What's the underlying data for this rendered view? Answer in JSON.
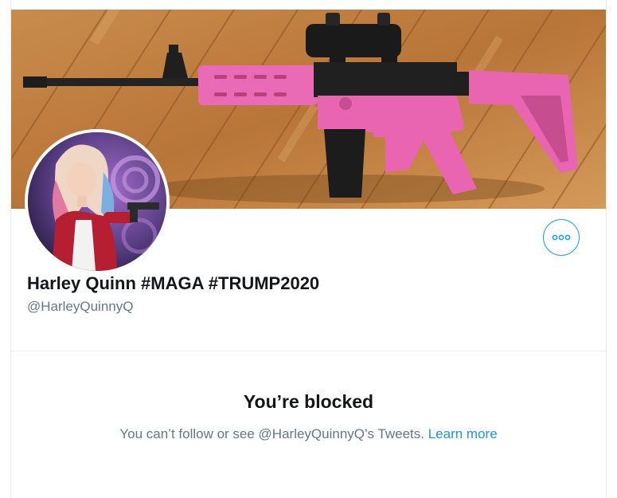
{
  "profile": {
    "display_name": "Harley Quinn #MAGA #TRUMP2020",
    "handle": "@HarleyQuinnyQ"
  },
  "blocked": {
    "title": "You’re blocked",
    "message": "You can’t follow or see @HarleyQuinnyQ’s Tweets.",
    "link_label": "Learn more"
  },
  "icons": {
    "more": "more-options-icon"
  },
  "colors": {
    "accent": "#1da1f2",
    "link": "#1b95e0",
    "text_primary": "#14171a",
    "text_secondary": "#657786",
    "border": "#e6ecf0"
  }
}
